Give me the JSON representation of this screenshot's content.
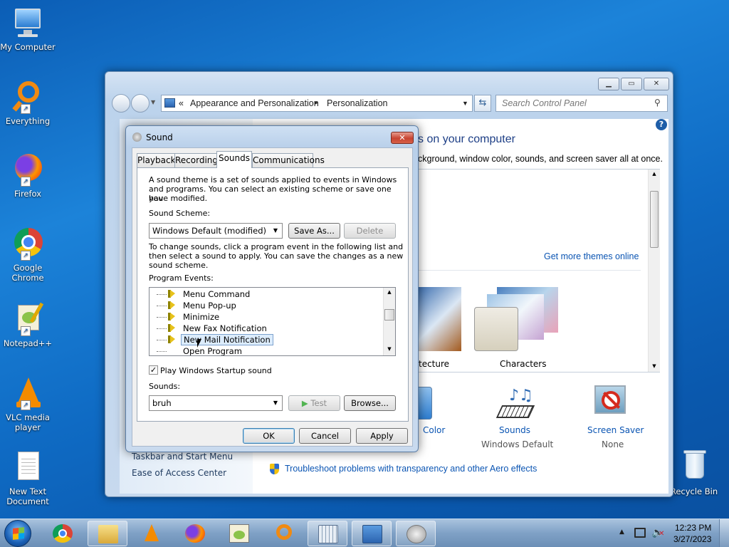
{
  "desktop": {
    "icons": [
      {
        "label": "My Computer"
      },
      {
        "label": "Everything"
      },
      {
        "label": "Firefox"
      },
      {
        "label": "Google Chrome"
      },
      {
        "label": "Notepad++"
      },
      {
        "label": "VLC media player"
      },
      {
        "label": "New Text Document"
      },
      {
        "label": "Recycle Bin"
      }
    ]
  },
  "control_panel": {
    "breadcrumb": {
      "prefix": "«",
      "item1": "Appearance and Personalization",
      "sep": "▸",
      "item2": "Personalization"
    },
    "search_placeholder": "Search Control Panel",
    "heading_partial": "s on your computer",
    "subheading_partial": "ckground, window color, sounds, and screen saver all at once.",
    "get_more_themes": "Get more themes online",
    "themes": [
      {
        "label": "tecture"
      },
      {
        "label": "Characters"
      }
    ],
    "left_links": [
      "Taskbar and Start Menu",
      "Ease of Access Center"
    ],
    "bottom_items": [
      {
        "title": "Color",
        "sub": ""
      },
      {
        "title": "Sounds",
        "sub": "Windows Default"
      },
      {
        "title": "Screen Saver",
        "sub": "None"
      }
    ],
    "troubleshoot_link": "Troubleshoot problems with transparency and other Aero effects",
    "buttons": {
      "minimize": "▁",
      "maximize": "▭",
      "close": "✕"
    }
  },
  "sound_dialog": {
    "title": "Sound",
    "tabs": [
      "Playback",
      "Recording",
      "Sounds",
      "Communications"
    ],
    "active_tab": "Sounds",
    "intro_lines": [
      "A sound theme is a set of sounds applied to events in Windows",
      "and programs.  You can select an existing scheme or save one you",
      "have modified."
    ],
    "scheme_label": "Sound Scheme:",
    "scheme_value": "Windows Default (modified)",
    "save_as": "Save As...",
    "delete": "Delete",
    "change_lines": [
      "To change sounds, click a program event in the following list and",
      "then select a sound to apply.  You can save the changes as a new",
      "sound scheme."
    ],
    "program_events_label": "Program Events:",
    "events": [
      {
        "label": "Menu Command",
        "selected": false
      },
      {
        "label": "Menu Pop-up",
        "selected": false
      },
      {
        "label": "Minimize",
        "selected": false
      },
      {
        "label": "New Fax Notification",
        "selected": false
      },
      {
        "label": "New Mail Notification",
        "selected": true
      },
      {
        "label": "Open Program",
        "selected": false
      }
    ],
    "startup_checkbox": {
      "label": "Play Windows Startup sound",
      "checked": true
    },
    "sounds_label": "Sounds:",
    "sound_value": "bruh",
    "test": "Test",
    "browse": "Browse...",
    "ok": "OK",
    "cancel": "Cancel",
    "apply": "Apply"
  },
  "taskbar": {
    "time": "12:23 PM",
    "date": "3/27/2023"
  },
  "colors": {
    "link": "#0b55b3",
    "desktop": "#1c83d9"
  }
}
